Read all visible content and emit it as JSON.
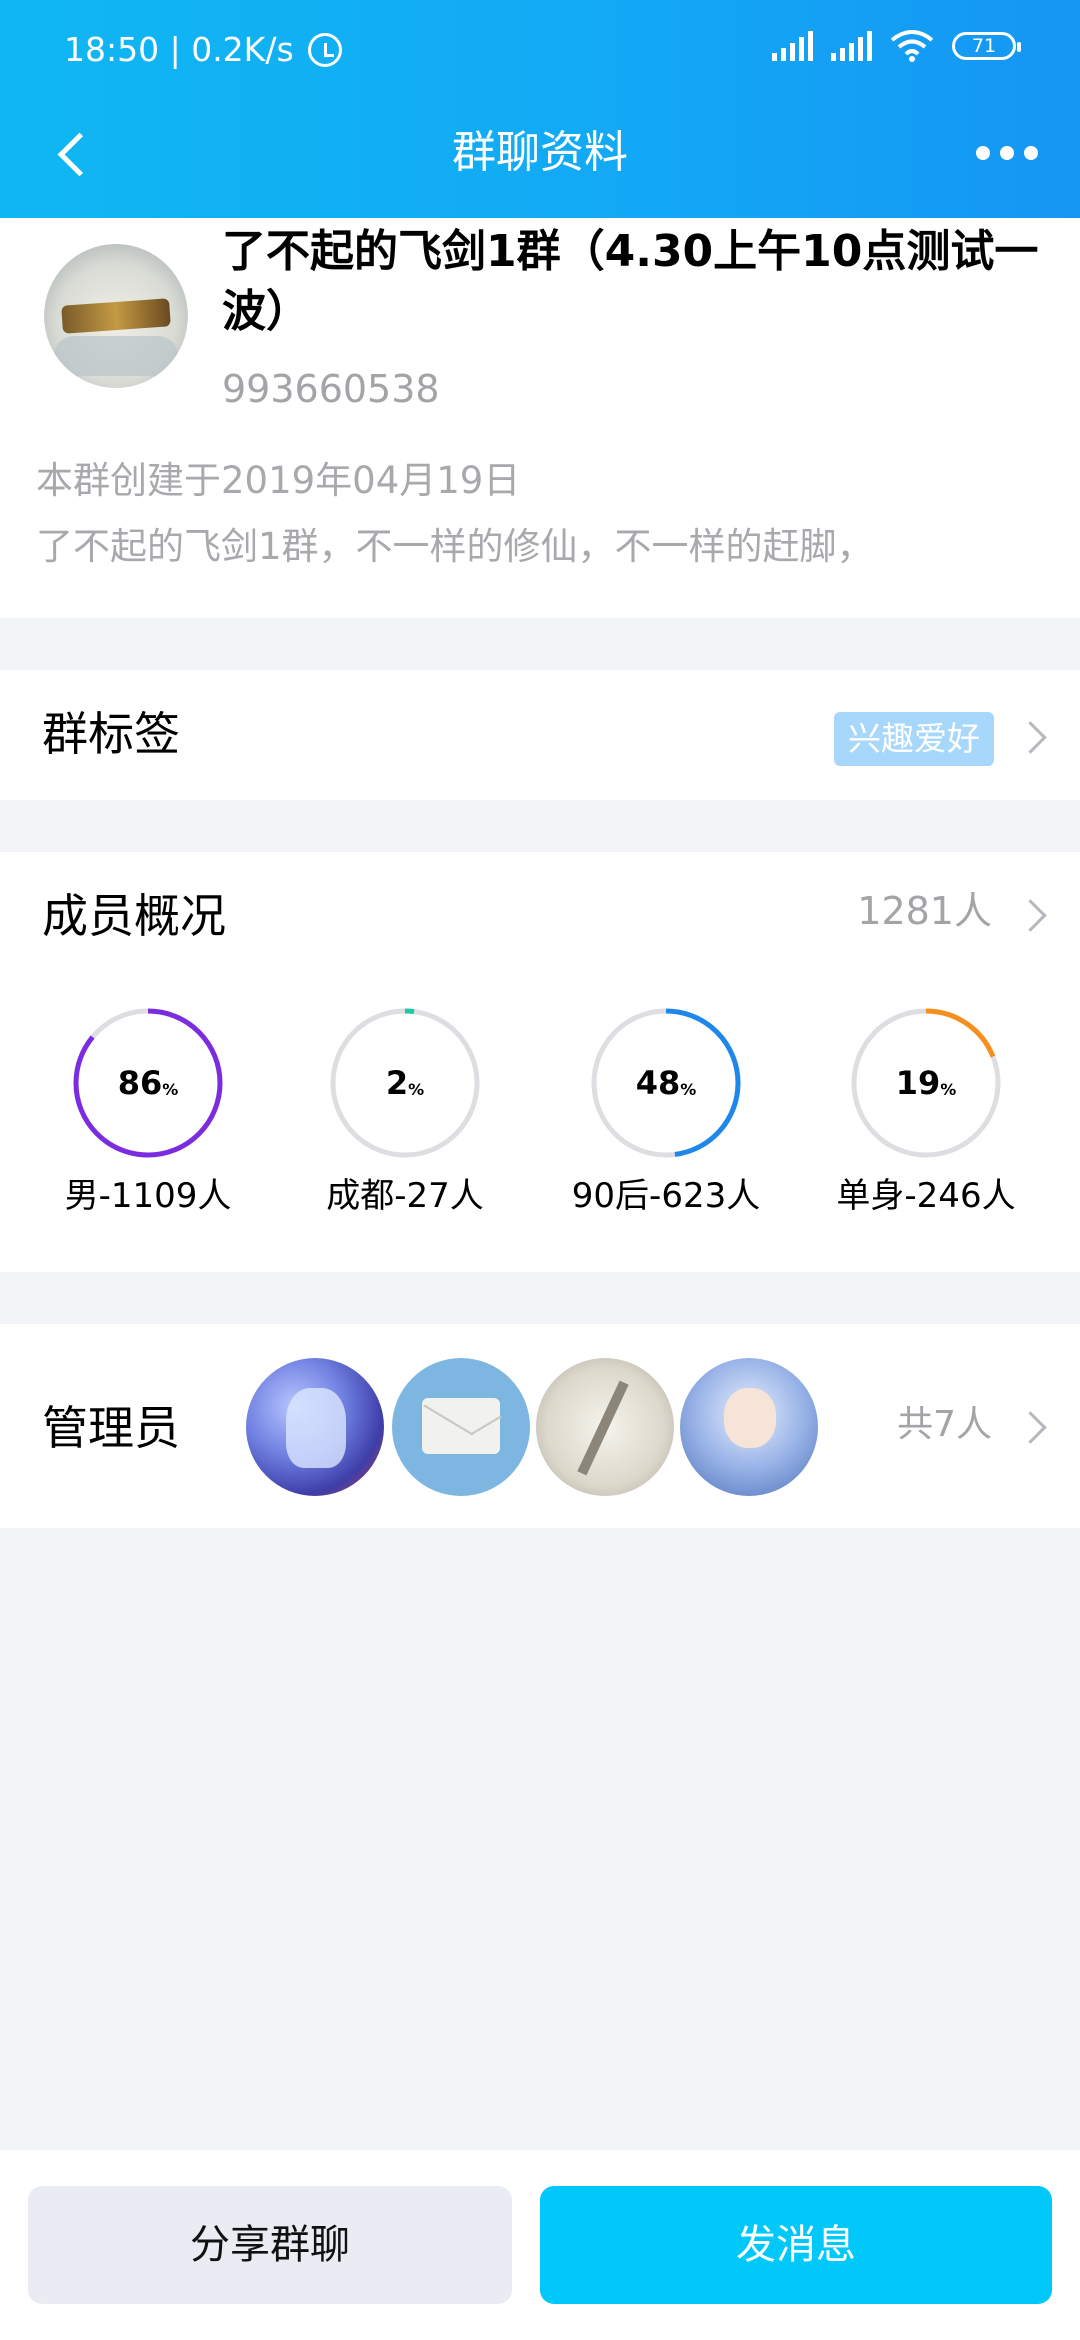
{
  "status_bar": {
    "time_speed": "18:50 | 0.2K/s",
    "battery": "71"
  },
  "nav": {
    "title": "群聊资料"
  },
  "group": {
    "name": "了不起的飞剑1群（4.30上午10点测试一波）",
    "id": "993660538",
    "created": "本群创建于2019年04月19日",
    "description": "了不起的飞剑1群，不一样的修仙，不一样的赶脚，"
  },
  "tags": {
    "label": "群标签",
    "tag": "兴趣爱好"
  },
  "members": {
    "label": "成员概况",
    "count": "1281人",
    "stats": [
      {
        "value": "86",
        "unit": "%",
        "fraction": 0.86,
        "label": "男-1109人",
        "color": "#7b2be0"
      },
      {
        "value": "2",
        "unit": "%",
        "fraction": 0.02,
        "label": "成都-27人",
        "color": "#1ccaa0"
      },
      {
        "value": "48",
        "unit": "%",
        "fraction": 0.48,
        "label": "90后-623人",
        "color": "#1e87ea"
      },
      {
        "value": "19",
        "unit": "%",
        "fraction": 0.19,
        "label": "单身-246人",
        "color": "#f5901f"
      }
    ]
  },
  "admins": {
    "label": "管理员",
    "count": "共7人"
  },
  "buttons": {
    "share": "分享群聊",
    "send": "发消息"
  }
}
